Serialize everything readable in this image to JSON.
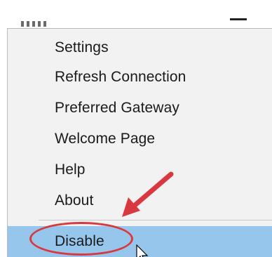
{
  "menu": {
    "items": [
      {
        "label": "Settings"
      },
      {
        "label": "Refresh Connection"
      },
      {
        "label": "Preferred Gateway"
      },
      {
        "label": "Welcome Page"
      },
      {
        "label": "Help"
      },
      {
        "label": "About"
      },
      {
        "label": "Disable"
      }
    ],
    "highlighted_item": "Disable"
  },
  "colors": {
    "highlight": "#97c6ec",
    "annotation": "#d9393e",
    "menu_background": "#f2f2f2"
  },
  "icons": {
    "window_control": "minimize-icon",
    "pointer": "mouse-cursor-icon",
    "callout": "arrow-annotation-icon"
  }
}
